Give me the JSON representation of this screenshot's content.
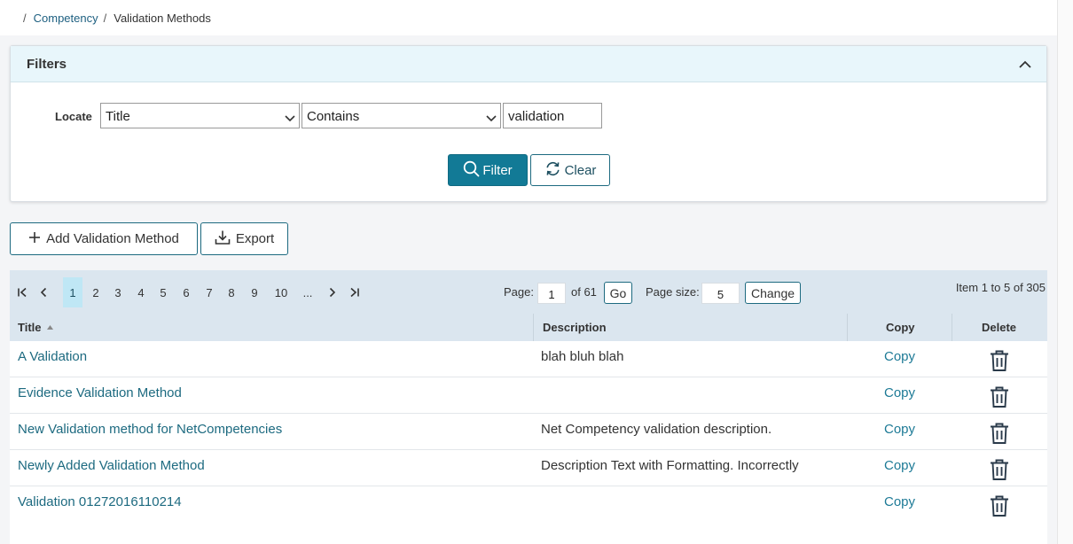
{
  "breadcrumb": {
    "sep": "/",
    "parent": "Competency",
    "current": "Validation Methods"
  },
  "filters": {
    "title": "Filters",
    "locate_label": "Locate",
    "field_value": "Title",
    "operator_value": "Contains",
    "search_value": "validation",
    "filter_label": "Filter",
    "clear_label": "Clear"
  },
  "toolbar": {
    "add_label": "Add Validation Method",
    "export_label": "Export"
  },
  "pager": {
    "pages": [
      "1",
      "2",
      "3",
      "4",
      "5",
      "6",
      "7",
      "8",
      "9",
      "10",
      "..."
    ],
    "active_page": "1",
    "page_label": "Page:",
    "page_value": "1",
    "of_label": "of 61",
    "go_label": "Go",
    "page_size_label": "Page size:",
    "page_size_value": "5",
    "change_label": "Change",
    "item_count": "Item 1 to 5 of 305"
  },
  "columns": {
    "title": "Title",
    "description": "Description",
    "copy": "Copy",
    "delete": "Delete"
  },
  "rows": [
    {
      "title": "A Validation",
      "description": "blah bluh blah",
      "copy": "Copy"
    },
    {
      "title": "Evidence Validation Method",
      "description": "",
      "copy": "Copy"
    },
    {
      "title": "New Validation method for NetCompetencies",
      "description": "Net Competency validation description.",
      "copy": "Copy"
    },
    {
      "title": "Newly Added Validation Method",
      "description": "Description Text with Formatting. Incorrectly",
      "copy": "Copy"
    },
    {
      "title": "Validation 01272016110214",
      "description": "",
      "copy": "Copy"
    }
  ],
  "colors": {
    "accent": "#127a96",
    "link": "#1d6a80",
    "header_bg": "#dbe6ef",
    "filters_header_bg": "#e8f6fb"
  }
}
